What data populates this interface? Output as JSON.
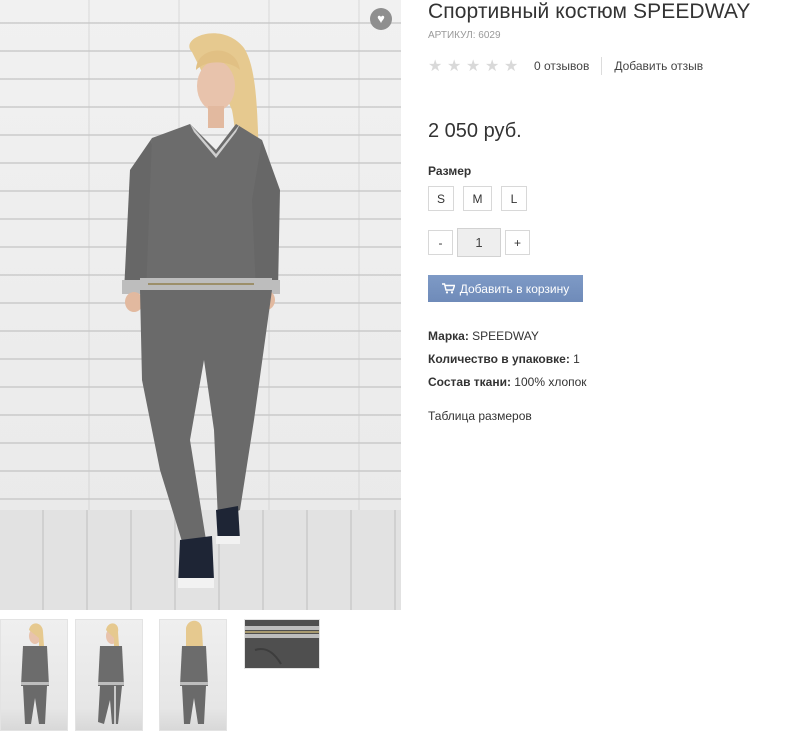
{
  "product": {
    "title": "Спортивный костюм SPEEDWAY",
    "sku": "АРТИКУЛ: 6029",
    "rating": {
      "stars_filled": 0,
      "stars_total": 5
    },
    "reviews_count": "0 отзывов",
    "add_review": "Добавить отзыв",
    "price": "2 050 руб.",
    "size_label": "Размер",
    "sizes": [
      "S",
      "M",
      "L"
    ],
    "quantity": {
      "minus": "-",
      "value": "1",
      "plus": "+"
    },
    "cart_button": "Добавить в корзину",
    "attributes": [
      {
        "label": "Марка:",
        "value": "SPEEDWAY"
      },
      {
        "label": "Количество в упаковке:",
        "value": "1"
      },
      {
        "label": "Состав ткани:",
        "value": "100% хлопок"
      }
    ],
    "size_table_link": "Таблица размеров"
  },
  "icons": {
    "favorite": "heart-icon",
    "star": "star-icon",
    "cart": "cart-icon"
  },
  "colors": {
    "cart_button": "#7591bf",
    "star_empty": "#d9d9d9",
    "suit": "#6b6b6b",
    "favorite_bg": "#8f8f8f"
  }
}
